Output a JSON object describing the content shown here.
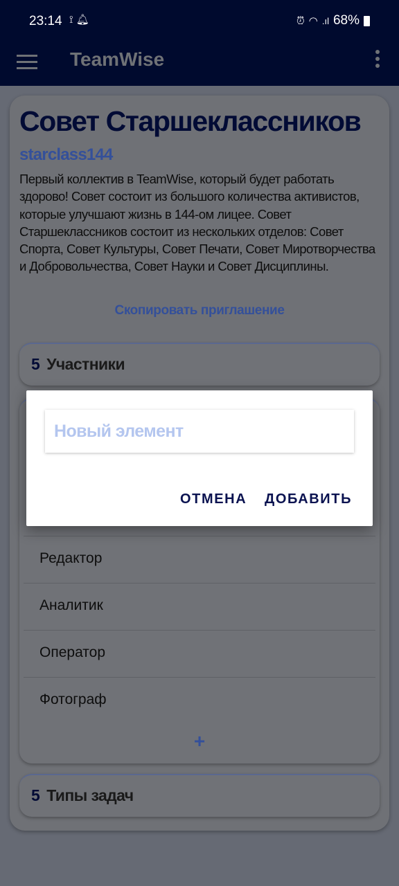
{
  "status": {
    "time": "23:14",
    "battery": "68%",
    "left_icons": [
      "cast-icon",
      "notification-bell-icon"
    ],
    "right_icons": [
      "alarm-icon",
      "wifi-icon",
      "signal-icon",
      "battery-icon"
    ]
  },
  "appbar": {
    "title": "TeamWise"
  },
  "team": {
    "name": "Совет Старшеклассников",
    "username": "starclass144",
    "description": "Первый коллектив в TeamWise, который будет работать здорово! Совет состоит из большого количества активистов, которые улучшают жизнь в 144-ом лицее. Совет Старшеклассников состоит из нескольких отделов: Совет Спорта, Совет Культуры, Совет Печати, Совет Миротворчества и Добровольчества, Совет Науки и Совет Дисциплины.",
    "copy_invite": "Скопировать приглашение"
  },
  "members": {
    "count": "5",
    "label": "Участники"
  },
  "roles": {
    "items": [
      "Редактор",
      "Аналитик",
      "Оператор",
      "Фотограф"
    ],
    "add": "+"
  },
  "task_types": {
    "count": "5",
    "label": "Типы задач"
  },
  "dialog": {
    "placeholder": "Новый элемент",
    "cancel": "ОТМЕНА",
    "add": "ДОБАВИТЬ"
  }
}
